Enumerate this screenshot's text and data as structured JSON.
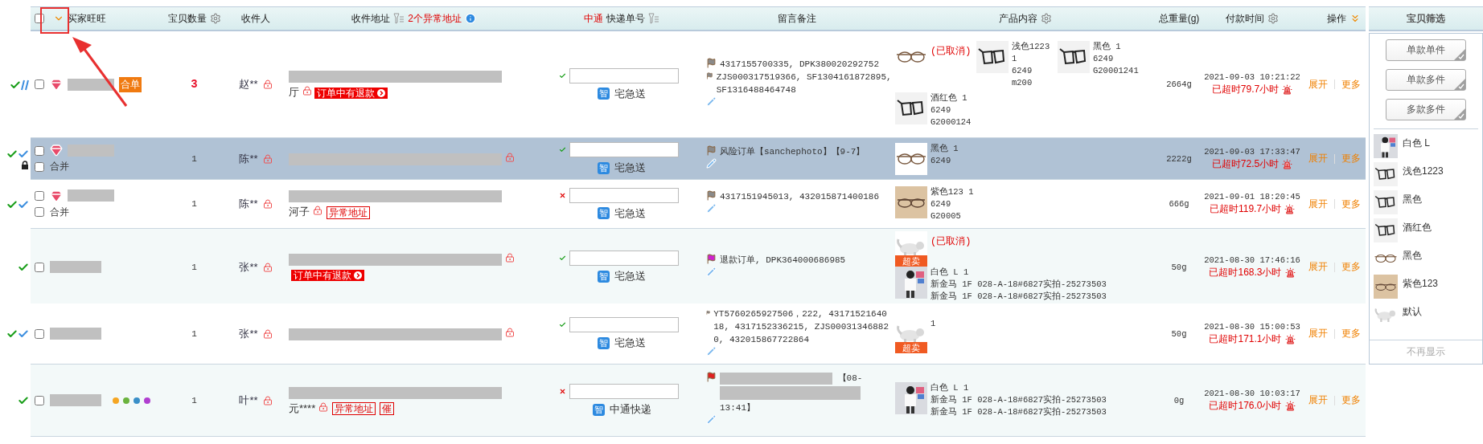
{
  "header": {
    "checked": false,
    "columns": [
      {
        "kind": "buyer",
        "label": "买家旺旺"
      },
      {
        "kind": "gear",
        "label": "宝贝数量"
      },
      {
        "kind": "plain",
        "label": "收件人"
      },
      {
        "kind": "address",
        "label": "收件地址",
        "alert": "2个异常地址"
      },
      {
        "kind": "express",
        "carrier": "中通",
        "label": "快递单号"
      },
      {
        "kind": "plain",
        "label": "留言备注"
      },
      {
        "kind": "gear",
        "label": "产品内容"
      },
      {
        "kind": "plain",
        "label": "总重量(g)"
      },
      {
        "kind": "gear",
        "label": "付款时间"
      },
      {
        "kind": "ops",
        "label": "操作"
      }
    ]
  },
  "rows": [
    {
      "selected": false,
      "checked": false,
      "locked": false,
      "marks": [
        {
          "kind": "check",
          "color": "#1a9e1a"
        },
        {
          "kind": "slashes",
          "color": "#3d8fdf"
        }
      ],
      "buyer": {
        "gem": true,
        "tag": "合单"
      },
      "count": "3",
      "count_alert": true,
      "receiver": "赵**",
      "address": {
        "text": "厅",
        "badges": [
          {
            "kind": "refund",
            "label": "订单中有退款"
          }
        ]
      },
      "express": {
        "status_ok": true,
        "smart": "智",
        "service": "宅急送"
      },
      "notes": [
        {
          "color": "#8a8a8a",
          "text": "4317155700335, DPK380020292752"
        },
        {
          "color": "#8a8a8a",
          "text": "ZJS000317519366, SF1304161872895, SF1316488464748"
        }
      ],
      "products": [
        {
          "kind": "glasses-round",
          "status": "(已取消)"
        },
        {
          "kind": "glasses-dark",
          "lines": [
            "浅色1223",
            "1",
            "6249",
            "m200"
          ]
        },
        {
          "kind": "glasses-dark",
          "lines": [
            "黑色 1",
            "6249",
            "G20001241"
          ]
        },
        {
          "kind": "glasses-dark",
          "lines": [
            "酒红色 1",
            "6249",
            "G2000124"
          ]
        }
      ],
      "weight": "2664g",
      "time": "2021-09-03 10:21:22",
      "overdue": "已超时79.7小时",
      "ops": [
        "展开",
        "更多"
      ]
    },
    {
      "selected": true,
      "checked": false,
      "locked": true,
      "merge": {
        "label": "合并",
        "checked": false
      },
      "marks": [
        {
          "kind": "check",
          "color": "#1a9e1a"
        },
        {
          "kind": "check",
          "color": "#3d8fdf"
        }
      ],
      "buyer": {
        "gem": true
      },
      "count": "1",
      "count_alert": false,
      "receiver": "陈**",
      "address": {},
      "express": {
        "status_ok": true,
        "smart": "智",
        "service": "宅急送"
      },
      "notes": [
        {
          "color": "#8a8a8a",
          "text": "风险订单【sanchephoto】【9-7】"
        }
      ],
      "products": [
        {
          "kind": "glasses-round",
          "lines": [
            "黑色 1",
            "6249"
          ]
        }
      ],
      "weight": "2222g",
      "time": "2021-09-03 17:33:47",
      "overdue": "已超时72.5小时",
      "ops": [
        "展开",
        "更多"
      ]
    },
    {
      "selected": false,
      "checked": false,
      "locked": false,
      "merge": {
        "label": "合并",
        "checked": false
      },
      "marks": [
        {
          "kind": "check",
          "color": "#1a9e1a"
        },
        {
          "kind": "check",
          "color": "#3d8fdf"
        }
      ],
      "buyer": {
        "gem": true
      },
      "count": "1",
      "count_alert": false,
      "receiver": "陈**",
      "address": {
        "text": "河子",
        "badges": [
          {
            "kind": "outline",
            "label": "异常地址"
          }
        ]
      },
      "express": {
        "status_ok": false,
        "smart": "智",
        "service": "宅急送"
      },
      "notes": [
        {
          "color": "#8a8a8a",
          "text": "4317151945013, 432015871400186"
        }
      ],
      "products": [
        {
          "kind": "glasses-beige",
          "lines": [
            "紫色123 1",
            "6249",
            "G20005"
          ]
        }
      ],
      "weight": "666g",
      "time": "2021-09-01 18:20:45",
      "overdue": "已超时119.7小时",
      "ops": [
        "展开",
        "更多"
      ]
    },
    {
      "selected": false,
      "checked": false,
      "locked": false,
      "marks": [
        {
          "kind": "check",
          "color": "#1a9e1a"
        }
      ],
      "buyer": {
        "gem": false
      },
      "count": "1",
      "count_alert": false,
      "receiver": "张**",
      "address": {
        "badges": [
          {
            "kind": "refund",
            "label": "订单中有退款"
          }
        ]
      },
      "express": {
        "status_ok": true,
        "smart": "智",
        "service": "宅急送"
      },
      "notes": [
        {
          "color": "#d020d0",
          "text": "退款订单, DPK364000686985"
        }
      ],
      "products": [
        {
          "kind": "cat",
          "badge": "超卖",
          "status": "(已取消)"
        },
        {
          "kind": "person",
          "lines": [
            "白色 L 1",
            "新金马 1F 028-A-18#6827实拍-25273503",
            "新金马 1F 028-A-18#6827实拍-25273503"
          ]
        }
      ],
      "weight": "50g",
      "time": "2021-08-30 17:46:16",
      "overdue": "已超时168.3小时",
      "ops": [
        "展开",
        "更多"
      ]
    },
    {
      "selected": false,
      "checked": false,
      "locked": false,
      "marks": [
        {
          "kind": "check",
          "color": "#1a9e1a"
        },
        {
          "kind": "check",
          "color": "#3d8fdf"
        }
      ],
      "buyer": {
        "gem": false
      },
      "count": "1",
      "count_alert": false,
      "receiver": "张**",
      "address": {},
      "express": {
        "status_ok": true,
        "smart": "智",
        "service": "宅急送"
      },
      "notes": [
        {
          "color": "#8a8a8a",
          "text": "YT5760265927506，222, 4317152164018, 4317152336215, ZJS000313468820, 432015867722864"
        }
      ],
      "products": [
        {
          "kind": "cat",
          "badge": "超卖",
          "lines": [
            "1"
          ]
        }
      ],
      "weight": "50g",
      "time": "2021-08-30 15:00:53",
      "overdue": "已超时171.1小时",
      "ops": [
        "展开",
        "更多"
      ]
    },
    {
      "selected": false,
      "checked": false,
      "locked": false,
      "marks": [
        {
          "kind": "check",
          "color": "#1a9e1a"
        }
      ],
      "buyer": {
        "gem": false,
        "dots": [
          {
            "color": "#f5a623"
          },
          {
            "color": "#6ab33e"
          },
          {
            "color": "#3a8fc8"
          },
          {
            "color": "#b03fd0"
          }
        ]
      },
      "count": "1",
      "count_alert": false,
      "receiver": "叶**",
      "address": {
        "text": "元****",
        "badges": [
          {
            "kind": "outline",
            "label": "异常地址"
          },
          {
            "kind": "outline",
            "label": "催"
          }
        ]
      },
      "express": {
        "status_ok": false,
        "smart": "智",
        "service": "中通快递"
      },
      "notes": [
        {
          "color": "#e02020",
          "kind": "redacted",
          "lead": "【08-",
          "tail": "13:41】"
        }
      ],
      "products": [
        {
          "kind": "person",
          "lines": [
            "白色 L 1",
            "新金马 1F 028-A-18#6827实拍-25273503",
            "新金马 1F 028-A-18#6827实拍-25273503"
          ]
        }
      ],
      "weight": "0g",
      "time": "2021-08-30 10:03:17",
      "overdue": "已超时176.0小时",
      "ops": [
        "展开",
        "更多"
      ]
    }
  ],
  "panel": {
    "title": "宝贝筛选",
    "buttons": [
      "单款单件",
      "单款多件",
      "多款多件"
    ],
    "items": [
      {
        "kind": "person",
        "label": "白色 L"
      },
      {
        "kind": "glasses-dark",
        "label": "浅色1223"
      },
      {
        "kind": "glasses-dark",
        "label": "黑色"
      },
      {
        "kind": "glasses-dark",
        "label": "酒红色"
      },
      {
        "kind": "glasses-round",
        "label": "黑色"
      },
      {
        "kind": "glasses-beige",
        "label": "紫色123"
      },
      {
        "kind": "cat",
        "label": "默认"
      }
    ],
    "footer": "不再显示"
  }
}
